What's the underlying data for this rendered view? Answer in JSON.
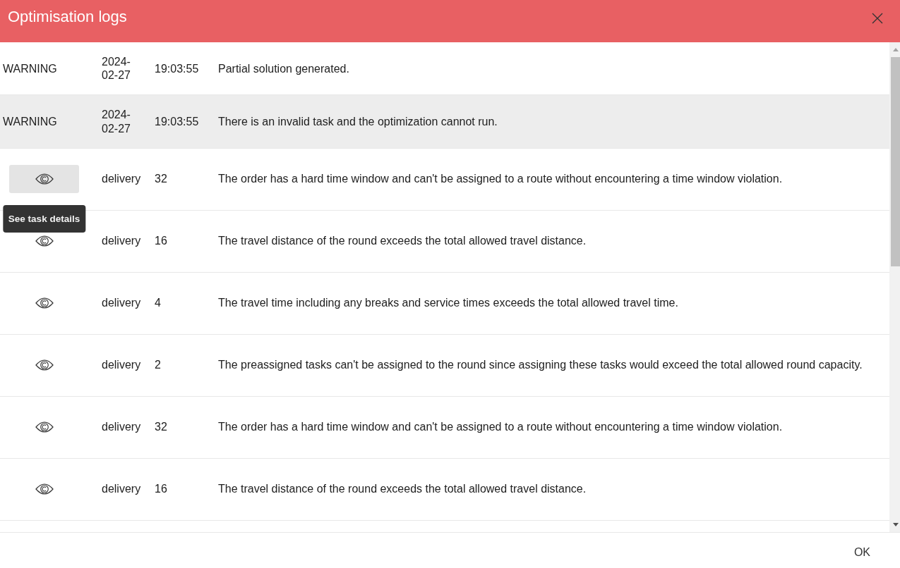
{
  "dialog": {
    "title": "Optimisation logs"
  },
  "log_entries": [
    {
      "kind": "log",
      "level": "WARNING",
      "date": "2024-02-27",
      "time": "19:03:55",
      "message": "Partial solution generated.",
      "highlighted": false
    },
    {
      "kind": "log",
      "level": "WARNING",
      "date": "2024-02-27",
      "time": "19:03:55",
      "message": "There is an invalid task and the optimization cannot run.",
      "highlighted": true
    },
    {
      "kind": "task",
      "task_type": "delivery",
      "task_number": "32",
      "message": "The order has a hard time window and can't be assigned to a route without encountering a time window violation.",
      "highlighted": false,
      "button_hovered": true,
      "tooltip": "See task details"
    },
    {
      "kind": "task",
      "task_type": "delivery",
      "task_number": "16",
      "message": "The travel distance of the round exceeds the total allowed travel distance.",
      "highlighted": false,
      "button_hovered": false
    },
    {
      "kind": "task",
      "task_type": "delivery",
      "task_number": "4",
      "message": "The travel time including any breaks and service times exceeds the total allowed travel time.",
      "highlighted": false,
      "button_hovered": false
    },
    {
      "kind": "task",
      "task_type": "delivery",
      "task_number": "2",
      "message": "The preassigned tasks can't be assigned to the round since assigning these tasks would exceed the total allowed round capacity.",
      "highlighted": false,
      "button_hovered": false
    },
    {
      "kind": "task",
      "task_type": "delivery",
      "task_number": "32",
      "message": "The order has a hard time window and can't be assigned to a route without encountering a time window violation.",
      "highlighted": false,
      "button_hovered": false
    },
    {
      "kind": "task",
      "task_type": "delivery",
      "task_number": "16",
      "message": "The travel distance of the round exceeds the total allowed travel distance.",
      "highlighted": false,
      "button_hovered": false
    }
  ],
  "footer": {
    "buttons": [
      "OK"
    ]
  }
}
